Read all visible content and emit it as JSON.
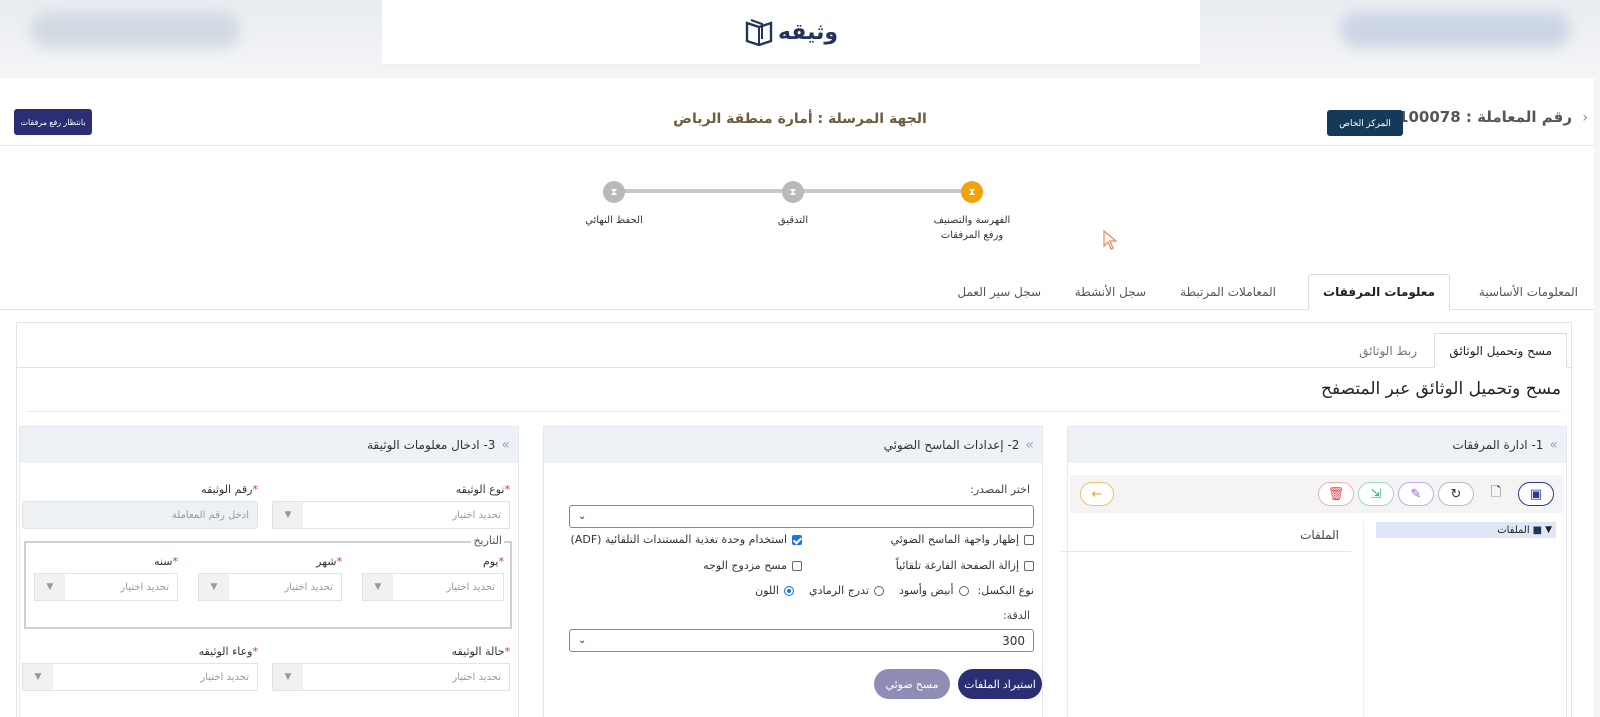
{
  "logo": {
    "text": "وثيقه"
  },
  "header": {
    "transaction_label": "رقم المعاملة : 1/1100078",
    "private_center_button": "المركز الخاص",
    "sender_label": "الجهة المرسلة : أمارة منطقة الرياض",
    "awaiting_button": "بانتظار رفع مرفقات"
  },
  "stepper": {
    "steps": [
      {
        "label_line1": "الفهرسة والتصنيف",
        "label_line2": "ورفع المرفقات",
        "state": "active"
      },
      {
        "label_line1": "التدقيق",
        "label_line2": "",
        "state": "pending"
      },
      {
        "label_line1": "الحفظ النهائي",
        "label_line2": "",
        "state": "pending"
      }
    ],
    "active_color": "#f2a20d"
  },
  "main_tabs": [
    {
      "label": "المعلومات الأساسية",
      "active": false
    },
    {
      "label": "معلومات المرفقات",
      "active": true
    },
    {
      "label": "المعاملات المرتبطة",
      "active": false
    },
    {
      "label": "سجل الأنشطة",
      "active": false
    },
    {
      "label": "سجل سير العمل",
      "active": false
    }
  ],
  "sub_tabs": [
    {
      "label": "مسح وتحميل الوثائق",
      "active": true
    },
    {
      "label": "ربط الوثائق",
      "active": false
    }
  ],
  "section_title": "مسح وتحميل الوثائق عبر المتصفح",
  "panel1": {
    "title": "1- ادارة المرفقات",
    "tree_root": "الملفات",
    "files_header": "الملفات"
  },
  "panel2": {
    "title": "2- إعدادات الماسح الضوئي",
    "source_label": "اختر المصدر:",
    "source_value": "",
    "options": {
      "show_ui": "إظهار واجهة الماسح الضوئي",
      "use_adf": "استخدام وحدة تغذية المستندات التلقائية (ADF)",
      "remove_blank": "إزالة الصفحة الفارغة تلقائياً",
      "duplex": "مسح مزدوج الوجه"
    },
    "pixel_type_label": "نوع البكسل:",
    "pixel_types": [
      "أبيض وأسود",
      "تدرج الرمادي",
      "اللون"
    ],
    "pixel_selected": "اللون",
    "resolution_label": "الدقة:",
    "resolution_value": "300",
    "import_button": "استيراد الملفات",
    "scan_button": "مسح ضوئي"
  },
  "panel3": {
    "title": "3- ادخال معلومات الوثيقة",
    "doc_type_label": "نوع الوثيقه",
    "doc_number_label": "رقم الوثيقه",
    "doc_number_placeholder": "ادخل رقم المعاملة",
    "date_legend": "التاريخ",
    "day_label": "يوم",
    "month_label": "شهر",
    "year_label": "سنه",
    "doc_status_label": "حالة الوثيقه",
    "doc_container_label": "وعاء الوثيقه",
    "select_placeholder": "تحديد اختيار",
    "required_mark": "*"
  }
}
